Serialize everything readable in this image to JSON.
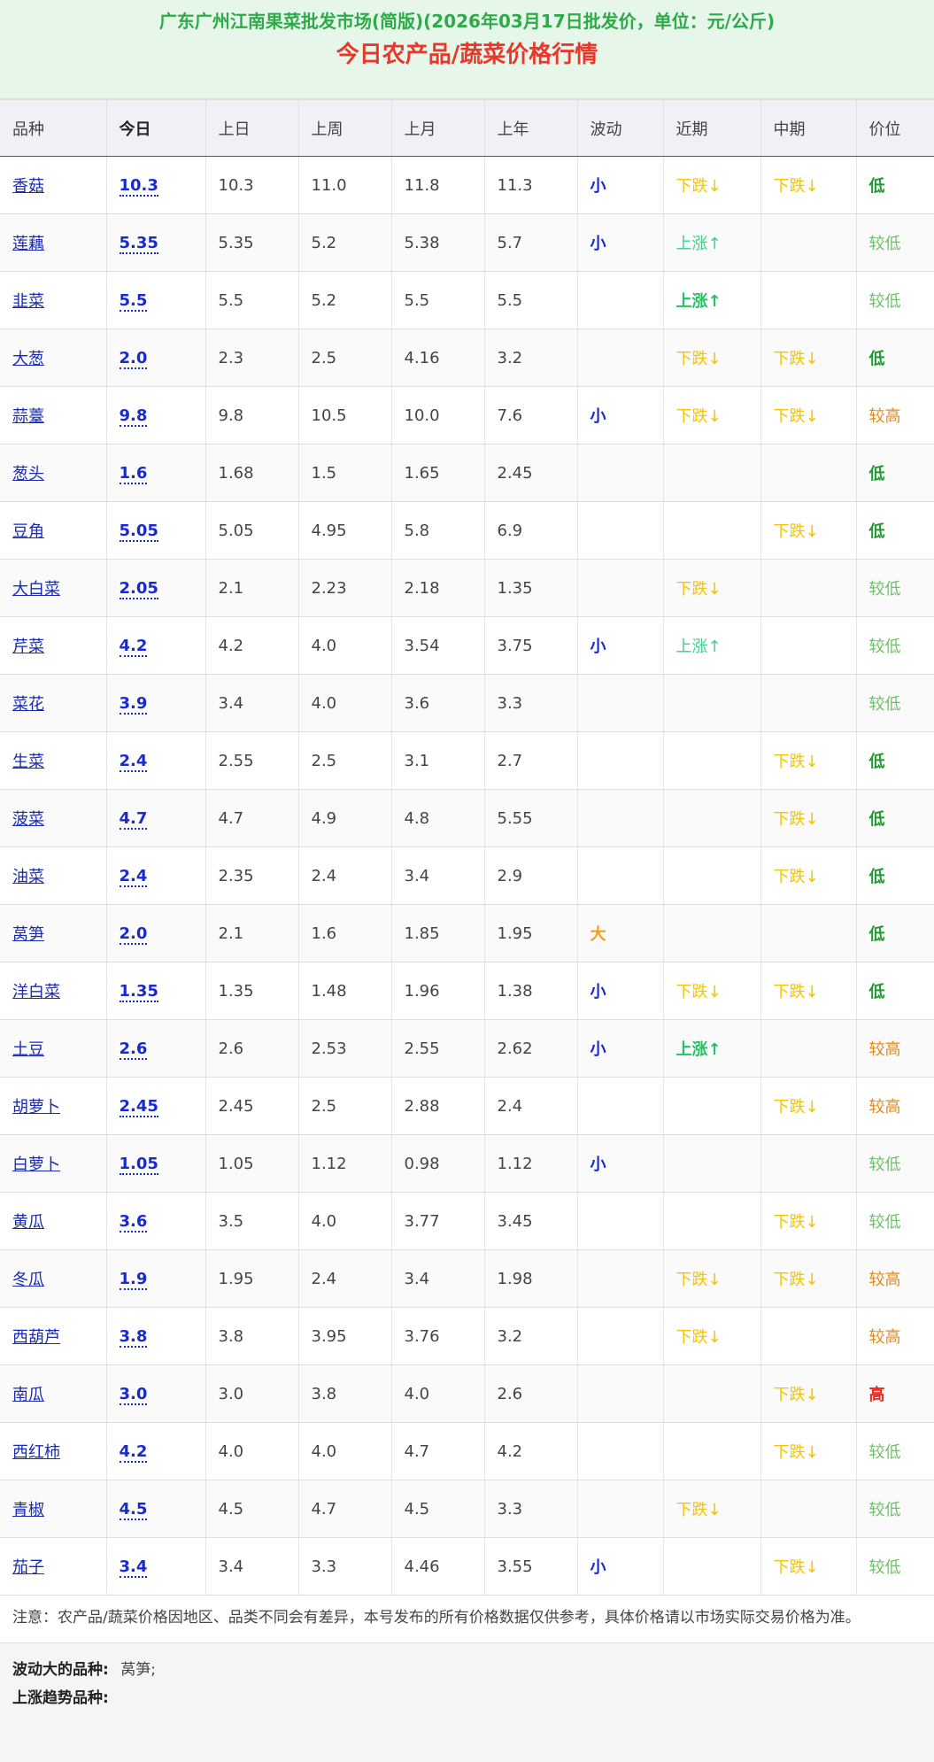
{
  "header": {
    "subtitle": "广东广州江南果菜批发市场(简版)(2026年03月17日批发价，单位：元/公斤)",
    "title": "今日农产品/蔬菜价格行情"
  },
  "columns": [
    "品种",
    "今日",
    "上日",
    "上周",
    "上月",
    "上年",
    "波动",
    "近期",
    "中期",
    "价位"
  ],
  "rows": [
    {
      "name": "香菇",
      "today": "10.3",
      "prev_day": "10.3",
      "prev_week": "11.0",
      "prev_month": "11.8",
      "prev_year": "11.3",
      "fluct": "小",
      "fluct_type": "small",
      "recent": "下跌↓",
      "recent_type": "down",
      "mid": "下跌↓",
      "mid_type": "down",
      "level": "低",
      "level_type": "low"
    },
    {
      "name": "莲藕",
      "today": "5.35",
      "prev_day": "5.35",
      "prev_week": "5.2",
      "prev_month": "5.38",
      "prev_year": "5.7",
      "fluct": "小",
      "fluct_type": "small",
      "recent": "上涨↑",
      "recent_type": "up",
      "mid": "",
      "mid_type": "",
      "level": "较低",
      "level_type": "lowish"
    },
    {
      "name": "韭菜",
      "today": "5.5",
      "prev_day": "5.5",
      "prev_week": "5.2",
      "prev_month": "5.5",
      "prev_year": "5.5",
      "fluct": "",
      "fluct_type": "",
      "recent": "上涨↑",
      "recent_type": "up-b",
      "mid": "",
      "mid_type": "",
      "level": "较低",
      "level_type": "lowish"
    },
    {
      "name": "大葱",
      "today": "2.0",
      "prev_day": "2.3",
      "prev_week": "2.5",
      "prev_month": "4.16",
      "prev_year": "3.2",
      "fluct": "",
      "fluct_type": "",
      "recent": "下跌↓",
      "recent_type": "down",
      "mid": "下跌↓",
      "mid_type": "down",
      "level": "低",
      "level_type": "low"
    },
    {
      "name": "蒜薹",
      "today": "9.8",
      "prev_day": "9.8",
      "prev_week": "10.5",
      "prev_month": "10.0",
      "prev_year": "7.6",
      "fluct": "小",
      "fluct_type": "small",
      "recent": "下跌↓",
      "recent_type": "down",
      "mid": "下跌↓",
      "mid_type": "down",
      "level": "较高",
      "level_type": "highish"
    },
    {
      "name": "葱头",
      "today": "1.6",
      "prev_day": "1.68",
      "prev_week": "1.5",
      "prev_month": "1.65",
      "prev_year": "2.45",
      "fluct": "",
      "fluct_type": "",
      "recent": "",
      "recent_type": "",
      "mid": "",
      "mid_type": "",
      "level": "低",
      "level_type": "low"
    },
    {
      "name": "豆角",
      "today": "5.05",
      "prev_day": "5.05",
      "prev_week": "4.95",
      "prev_month": "5.8",
      "prev_year": "6.9",
      "fluct": "",
      "fluct_type": "",
      "recent": "",
      "recent_type": "",
      "mid": "下跌↓",
      "mid_type": "down",
      "level": "低",
      "level_type": "low"
    },
    {
      "name": "大白菜",
      "today": "2.05",
      "prev_day": "2.1",
      "prev_week": "2.23",
      "prev_month": "2.18",
      "prev_year": "1.35",
      "fluct": "",
      "fluct_type": "",
      "recent": "下跌↓",
      "recent_type": "down",
      "mid": "",
      "mid_type": "",
      "level": "较低",
      "level_type": "lowish"
    },
    {
      "name": "芹菜",
      "today": "4.2",
      "prev_day": "4.2",
      "prev_week": "4.0",
      "prev_month": "3.54",
      "prev_year": "3.75",
      "fluct": "小",
      "fluct_type": "small",
      "recent": "上涨↑",
      "recent_type": "up",
      "mid": "",
      "mid_type": "",
      "level": "较低",
      "level_type": "lowish"
    },
    {
      "name": "菜花",
      "today": "3.9",
      "prev_day": "3.4",
      "prev_week": "4.0",
      "prev_month": "3.6",
      "prev_year": "3.3",
      "fluct": "",
      "fluct_type": "",
      "recent": "",
      "recent_type": "",
      "mid": "",
      "mid_type": "",
      "level": "较低",
      "level_type": "lowish"
    },
    {
      "name": "生菜",
      "today": "2.4",
      "prev_day": "2.55",
      "prev_week": "2.5",
      "prev_month": "3.1",
      "prev_year": "2.7",
      "fluct": "",
      "fluct_type": "",
      "recent": "",
      "recent_type": "",
      "mid": "下跌↓",
      "mid_type": "down",
      "level": "低",
      "level_type": "low"
    },
    {
      "name": "菠菜",
      "today": "4.7",
      "prev_day": "4.7",
      "prev_week": "4.9",
      "prev_month": "4.8",
      "prev_year": "5.55",
      "fluct": "",
      "fluct_type": "",
      "recent": "",
      "recent_type": "",
      "mid": "下跌↓",
      "mid_type": "down",
      "level": "低",
      "level_type": "low"
    },
    {
      "name": "油菜",
      "today": "2.4",
      "prev_day": "2.35",
      "prev_week": "2.4",
      "prev_month": "3.4",
      "prev_year": "2.9",
      "fluct": "",
      "fluct_type": "",
      "recent": "",
      "recent_type": "",
      "mid": "下跌↓",
      "mid_type": "down",
      "level": "低",
      "level_type": "low"
    },
    {
      "name": "莴笋",
      "today": "2.0",
      "prev_day": "2.1",
      "prev_week": "1.6",
      "prev_month": "1.85",
      "prev_year": "1.95",
      "fluct": "大",
      "fluct_type": "big",
      "recent": "",
      "recent_type": "",
      "mid": "",
      "mid_type": "",
      "level": "低",
      "level_type": "low"
    },
    {
      "name": "洋白菜",
      "today": "1.35",
      "prev_day": "1.35",
      "prev_week": "1.48",
      "prev_month": "1.96",
      "prev_year": "1.38",
      "fluct": "小",
      "fluct_type": "small",
      "recent": "下跌↓",
      "recent_type": "down",
      "mid": "下跌↓",
      "mid_type": "down",
      "level": "低",
      "level_type": "low"
    },
    {
      "name": "土豆",
      "today": "2.6",
      "prev_day": "2.6",
      "prev_week": "2.53",
      "prev_month": "2.55",
      "prev_year": "2.62",
      "fluct": "小",
      "fluct_type": "small",
      "recent": "上涨↑",
      "recent_type": "up-b",
      "mid": "",
      "mid_type": "",
      "level": "较高",
      "level_type": "highish"
    },
    {
      "name": "胡萝卜",
      "today": "2.45",
      "prev_day": "2.45",
      "prev_week": "2.5",
      "prev_month": "2.88",
      "prev_year": "2.4",
      "fluct": "",
      "fluct_type": "",
      "recent": "",
      "recent_type": "",
      "mid": "下跌↓",
      "mid_type": "down",
      "level": "较高",
      "level_type": "highish"
    },
    {
      "name": "白萝卜",
      "today": "1.05",
      "prev_day": "1.05",
      "prev_week": "1.12",
      "prev_month": "0.98",
      "prev_year": "1.12",
      "fluct": "小",
      "fluct_type": "small",
      "recent": "",
      "recent_type": "",
      "mid": "",
      "mid_type": "",
      "level": "较低",
      "level_type": "lowish"
    },
    {
      "name": "黄瓜",
      "today": "3.6",
      "prev_day": "3.5",
      "prev_week": "4.0",
      "prev_month": "3.77",
      "prev_year": "3.45",
      "fluct": "",
      "fluct_type": "",
      "recent": "",
      "recent_type": "",
      "mid": "下跌↓",
      "mid_type": "down",
      "level": "较低",
      "level_type": "lowish"
    },
    {
      "name": "冬瓜",
      "today": "1.9",
      "prev_day": "1.95",
      "prev_week": "2.4",
      "prev_month": "3.4",
      "prev_year": "1.98",
      "fluct": "",
      "fluct_type": "",
      "recent": "下跌↓",
      "recent_type": "down",
      "mid": "下跌↓",
      "mid_type": "down",
      "level": "较高",
      "level_type": "highish"
    },
    {
      "name": "西葫芦",
      "today": "3.8",
      "prev_day": "3.8",
      "prev_week": "3.95",
      "prev_month": "3.76",
      "prev_year": "3.2",
      "fluct": "",
      "fluct_type": "",
      "recent": "下跌↓",
      "recent_type": "down",
      "mid": "",
      "mid_type": "",
      "level": "较高",
      "level_type": "highish"
    },
    {
      "name": "南瓜",
      "today": "3.0",
      "prev_day": "3.0",
      "prev_week": "3.8",
      "prev_month": "4.0",
      "prev_year": "2.6",
      "fluct": "",
      "fluct_type": "",
      "recent": "",
      "recent_type": "",
      "mid": "下跌↓",
      "mid_type": "down",
      "level": "高",
      "level_type": "high"
    },
    {
      "name": "西红柿",
      "today": "4.2",
      "prev_day": "4.0",
      "prev_week": "4.0",
      "prev_month": "4.7",
      "prev_year": "4.2",
      "fluct": "",
      "fluct_type": "",
      "recent": "",
      "recent_type": "",
      "mid": "下跌↓",
      "mid_type": "down",
      "level": "较低",
      "level_type": "lowish"
    },
    {
      "name": "青椒",
      "today": "4.5",
      "prev_day": "4.5",
      "prev_week": "4.7",
      "prev_month": "4.5",
      "prev_year": "3.3",
      "fluct": "",
      "fluct_type": "",
      "recent": "下跌↓",
      "recent_type": "down",
      "mid": "",
      "mid_type": "",
      "level": "较低",
      "level_type": "lowish"
    },
    {
      "name": "茄子",
      "today": "3.4",
      "prev_day": "3.4",
      "prev_week": "3.3",
      "prev_month": "4.46",
      "prev_year": "3.55",
      "fluct": "小",
      "fluct_type": "small",
      "recent": "",
      "recent_type": "",
      "mid": "下跌↓",
      "mid_type": "down",
      "level": "较低",
      "level_type": "lowish"
    }
  ],
  "note": "注意：农产品/蔬菜价格因地区、品类不同会有差异，本号发布的所有价格数据仅供参考，具体价格请以市场实际交易价格为准。",
  "summary": {
    "big_fluct_label": "波动大的品种:",
    "big_fluct_value": "莴笋;",
    "up_trend_label": "上涨趋势品种:",
    "up_trend_value": ""
  },
  "colors": {
    "header_bg": "#e6f7e9",
    "subtitle": "#2faa4a",
    "title": "#e8382c",
    "link": "#1a2bb3",
    "down": "#f5c400",
    "up": "#3dd08a",
    "low": "#1f9a2e",
    "highish": "#e08a1a",
    "high": "#e8281c"
  }
}
